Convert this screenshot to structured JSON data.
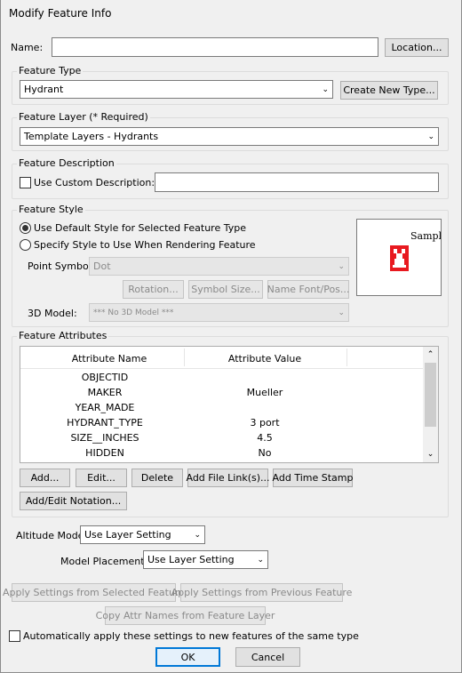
{
  "window": {
    "title": "Modify Feature Info"
  },
  "name_row": {
    "label": "Name:",
    "value": "",
    "location_button": "Location..."
  },
  "feature_type": {
    "title": "Feature Type",
    "selected": "Hydrant",
    "create_button": "Create New Type..."
  },
  "feature_layer": {
    "title": "Feature Layer (* Required)",
    "selected": "Template Layers - Hydrants"
  },
  "feature_description": {
    "title": "Feature Description",
    "checkbox_label": "Use Custom Description:",
    "value": ""
  },
  "feature_style": {
    "title": "Feature Style",
    "radio_default": "Use Default Style for Selected Feature Type",
    "radio_specify": "Specify Style to Use When Rendering Feature",
    "point_symbol_label": "Point Symbol",
    "point_symbol_value": "Dot",
    "rotation_button": "Rotation...",
    "symbol_size_button": "Symbol Size...",
    "name_font_button": "Name Font/Pos...",
    "model_label": "3D Model:",
    "model_value": "*** No 3D Model ***",
    "preview_text": "Sample"
  },
  "feature_attributes": {
    "title": "Feature Attributes",
    "columns": [
      "Attribute Name",
      "Attribute Value"
    ],
    "rows": [
      {
        "name": "OBJECTID",
        "value": ""
      },
      {
        "name": "MAKER",
        "value": "Mueller"
      },
      {
        "name": "YEAR_MADE",
        "value": ""
      },
      {
        "name": "HYDRANT_TYPE",
        "value": "3 port"
      },
      {
        "name": "SIZE__INCHES",
        "value": "4.5"
      },
      {
        "name": "HIDDEN",
        "value": "No"
      }
    ],
    "buttons": {
      "add": "Add...",
      "edit": "Edit...",
      "delete": "Delete",
      "add_file_links": "Add File Link(s)...",
      "add_time_stamp": "Add Time Stamp",
      "add_edit_notation": "Add/Edit Notation..."
    }
  },
  "altitude": {
    "label": "Altitude Mode:",
    "value": "Use Layer Setting"
  },
  "model_placement": {
    "label": "Model Placement:",
    "value": "Use Layer Setting"
  },
  "apply_buttons": {
    "from_selected": "Apply Settings from Selected Feature",
    "from_previous": "Apply Settings from Previous Feature",
    "copy_attr_names": "Copy Attr Names from Feature Layer"
  },
  "auto_apply": {
    "label": "Automatically apply these settings to new features of the same type"
  },
  "dialog_buttons": {
    "ok": "OK",
    "cancel": "Cancel"
  },
  "colors": {
    "accent": "#0078d7",
    "hydrant_red": "#e8191f"
  }
}
